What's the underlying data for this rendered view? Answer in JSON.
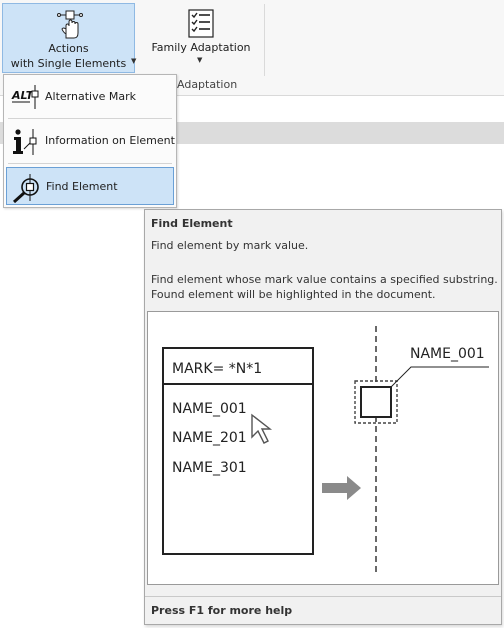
{
  "ribbon": {
    "actions_button": {
      "line1": "Actions",
      "line2": "with Single Elements",
      "icon": "hand-icon"
    },
    "family_button": {
      "label": "Family Adaptation",
      "icon": "checklist-icon"
    },
    "group_label": "Adaptation"
  },
  "menu": {
    "items": [
      {
        "label": "Alternative Mark",
        "icon": "alt-mark-icon",
        "highlighted": false
      },
      {
        "label": "Information on Element",
        "icon": "info-element-icon",
        "highlighted": false
      },
      {
        "label": "Find Element",
        "icon": "find-element-icon",
        "highlighted": true
      }
    ]
  },
  "tooltip": {
    "title": "Find Element",
    "summary": "Find element by mark value.",
    "description_line1": "Find element whose mark value contains a specified substring.",
    "description_line2": "Found element will be highlighted in the document.",
    "help": "Press F1 for more help",
    "illustration": {
      "filter_text": "MARK= *N*1",
      "results": [
        "NAME_001",
        "NAME_201",
        "NAME_301"
      ],
      "callout_label": "NAME_001"
    }
  },
  "colors": {
    "highlight_fill": "#cde3f7",
    "highlight_border": "#6aa0d6",
    "arrow": "#8a8a8a",
    "tooltip_bg": "#f1f1f1"
  }
}
